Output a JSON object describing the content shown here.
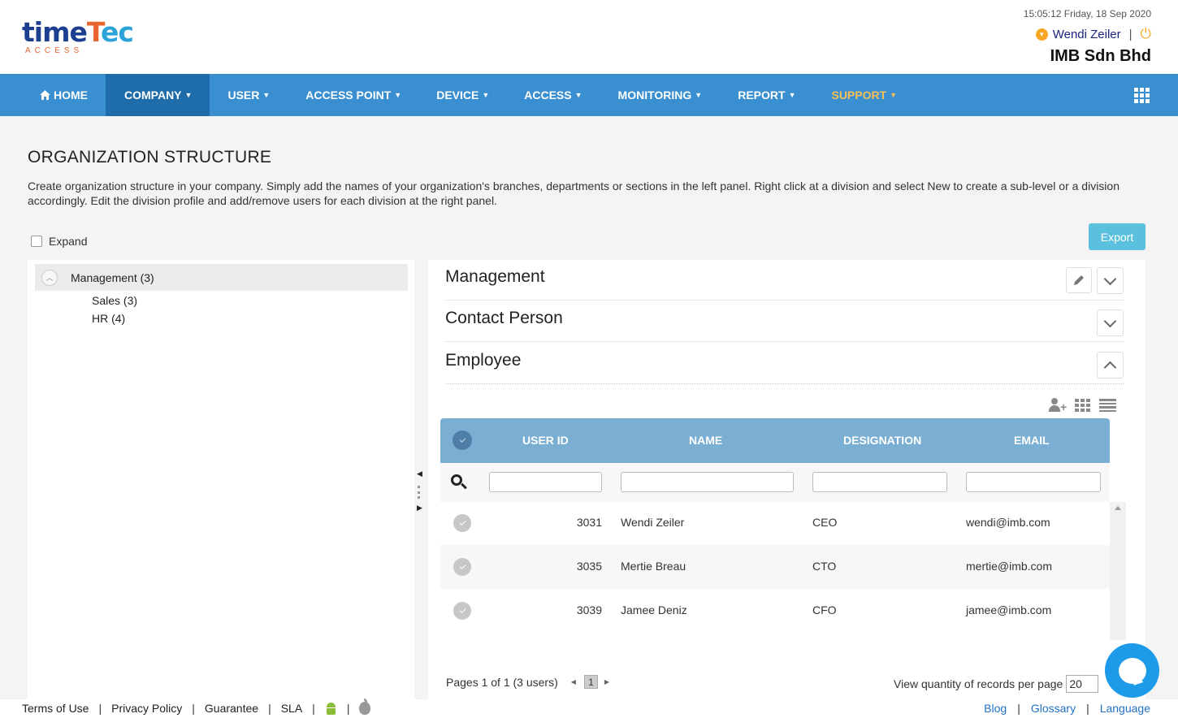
{
  "header": {
    "logo_main_a": "time",
    "logo_main_t": "T",
    "logo_main_b": "ec",
    "logo_sub": "ACCESS",
    "datetime": "15:05:12 Friday, 18 Sep 2020",
    "user_name": "Wendi Zeiler",
    "company": "IMB Sdn Bhd"
  },
  "nav": {
    "items": [
      {
        "label": "HOME",
        "icon": "home-icon"
      },
      {
        "label": "COMPANY"
      },
      {
        "label": "USER"
      },
      {
        "label": "ACCESS POINT"
      },
      {
        "label": "DEVICE"
      },
      {
        "label": "ACCESS"
      },
      {
        "label": "MONITORING"
      },
      {
        "label": "REPORT"
      },
      {
        "label": "SUPPORT"
      }
    ],
    "active": "COMPANY",
    "accent_color": "#3a8fd1",
    "active_color": "#1f6cab",
    "support_color": "#f8c055"
  },
  "page": {
    "title": "ORGANIZATION STRUCTURE",
    "description": "Create organization structure in your company. Simply add the names of your organization's branches, departments or sections in the left panel. Right click at a division and select New to create a sub-level or a division accordingly. Edit the division profile and add/remove users for each division at the right panel.",
    "expand_label": "Expand",
    "export_label": "Export"
  },
  "tree": {
    "root": "Management (3)",
    "children": [
      "Sales (3)",
      "HR (4)"
    ]
  },
  "sections": {
    "management": "Management",
    "contact": "Contact Person",
    "employee": "Employee"
  },
  "table": {
    "headers": [
      "USER ID",
      "NAME",
      "DESIGNATION",
      "EMAIL"
    ],
    "rows": [
      {
        "id": "3031",
        "name": "Wendi Zeiler",
        "designation": "CEO",
        "email": "wendi@imb.com"
      },
      {
        "id": "3035",
        "name": "Mertie Breau",
        "designation": "CTO",
        "email": "mertie@imb.com"
      },
      {
        "id": "3039",
        "name": "Jamee Deniz",
        "designation": "CFO",
        "email": "jamee@imb.com"
      }
    ]
  },
  "pager": {
    "summary": "Pages 1 of 1 (3 users)",
    "current_page": "1",
    "per_page_label": "View quantity of records per page",
    "per_page_value": "20"
  },
  "footer": {
    "left": [
      "Terms of Use",
      "Privacy Policy",
      "Guarantee",
      "SLA"
    ],
    "right": [
      "Blog",
      "Glossary",
      "Language"
    ]
  }
}
